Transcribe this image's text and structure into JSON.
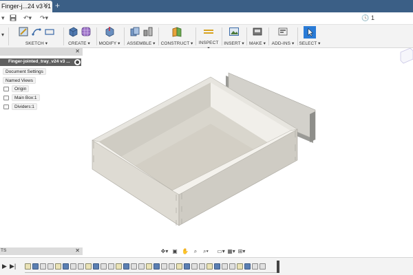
{
  "tab": {
    "title": "Finger-j...24 v3 v1"
  },
  "quick_access": {
    "job_count": "1"
  },
  "toolbar": {
    "groups": [
      {
        "label": "SKETCH ▾"
      },
      {
        "label": "CREATE ▾"
      },
      {
        "label": "MODIFY ▾"
      },
      {
        "label": "ASSEMBLE ▾"
      },
      {
        "label": "CONSTRUCT ▾"
      },
      {
        "label": "INSPECT ▾"
      },
      {
        "label": "INSERT ▾"
      },
      {
        "label": "MAKE ▾"
      },
      {
        "label": "ADD-INS ▾"
      },
      {
        "label": "SELECT ▾"
      }
    ]
  },
  "browser": {
    "header": "",
    "root": "Finger-jointed_tray_v24 v3 ...",
    "items": [
      {
        "label": "Document Settings"
      },
      {
        "label": "Named Views"
      },
      {
        "label": "Origin"
      },
      {
        "label": "Main Box:1"
      },
      {
        "label": "Dividers:1"
      }
    ]
  },
  "comments": {
    "label": "TS"
  },
  "colors": {
    "tab_bar": "#3b5f86",
    "accent_select": "#2a7bd6",
    "model_face": "#dedbd3"
  },
  "icons": [
    "save-icon",
    "undo-icon",
    "redo-icon",
    "clock-icon",
    "orbit-icon",
    "pan-icon",
    "zoom-icon",
    "display-icon",
    "grid-icon"
  ]
}
